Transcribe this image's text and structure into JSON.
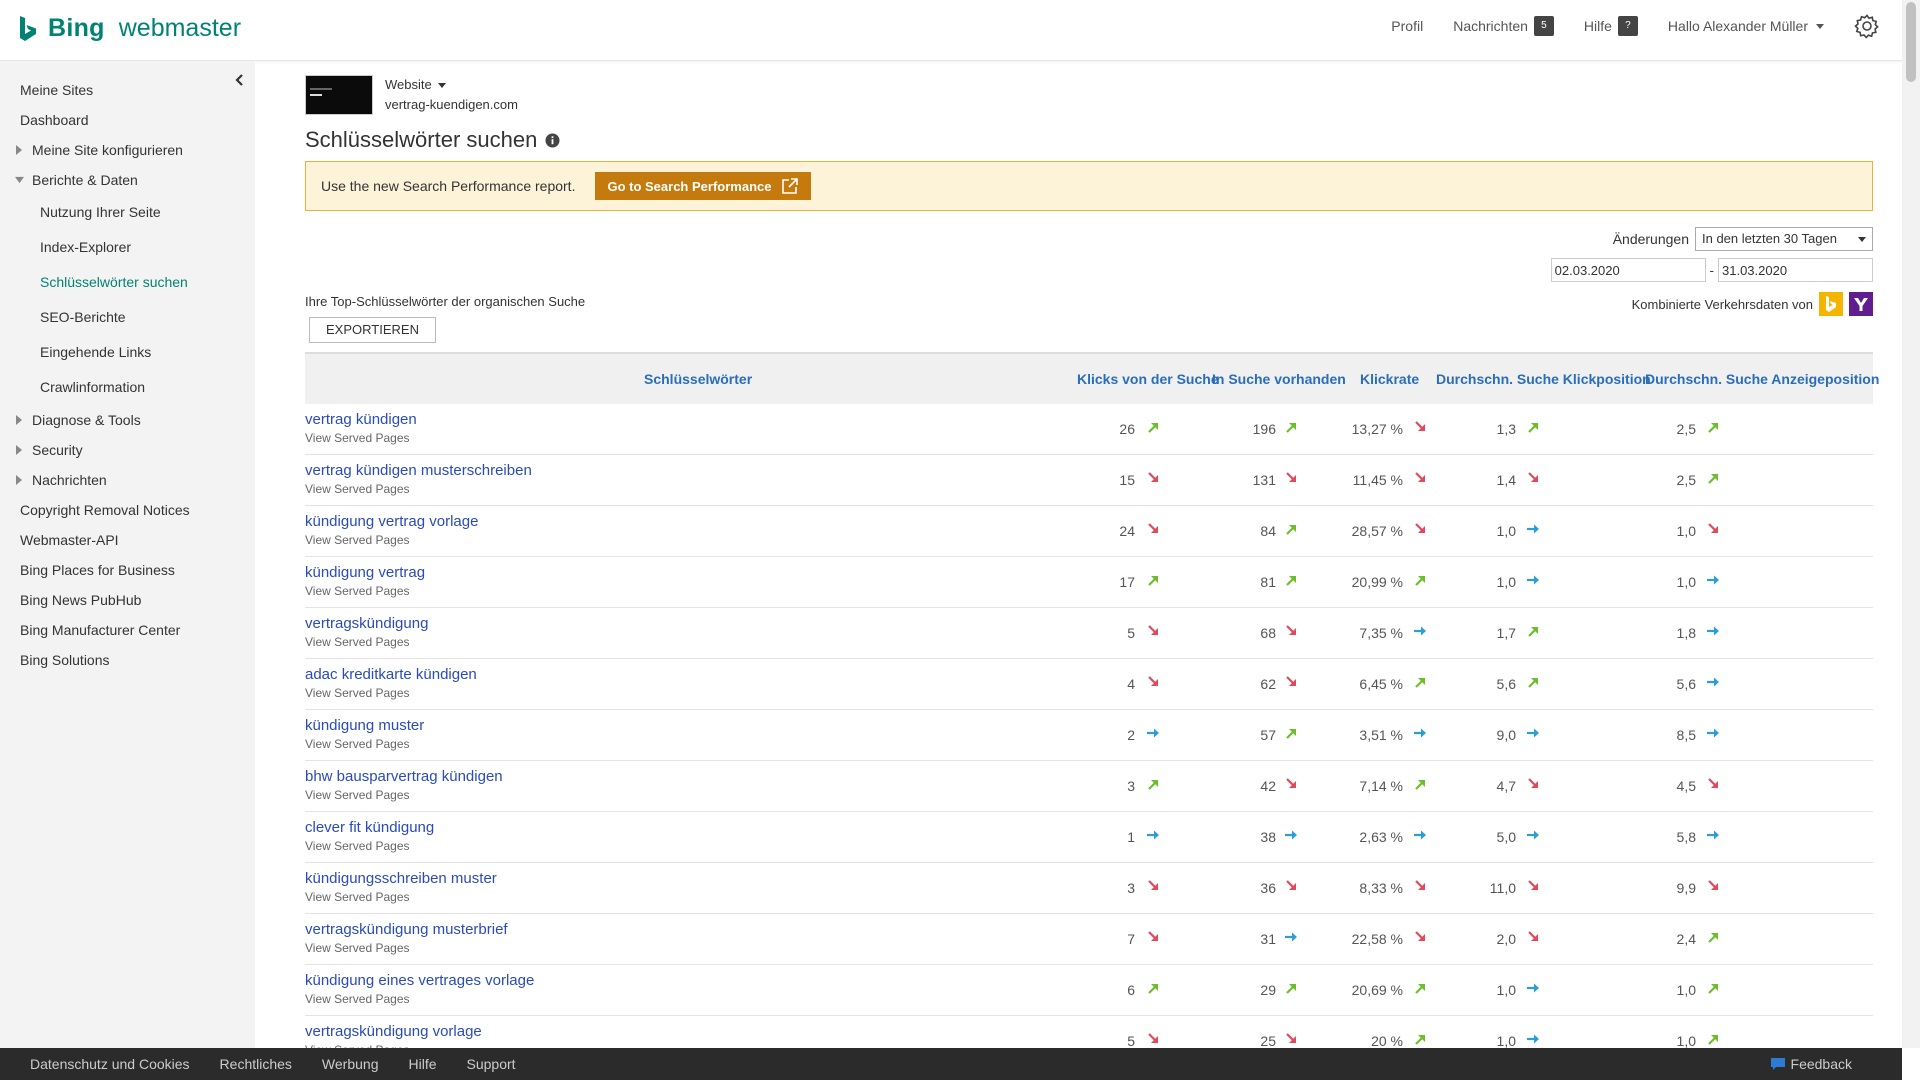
{
  "header": {
    "brand": "Bing",
    "product": "webmaster",
    "profile": "Profil",
    "messages": "Nachrichten",
    "messages_count": "5",
    "help": "Hilfe",
    "help_badge": "?",
    "greeting": "Hallo Alexander Müller"
  },
  "sidebar": {
    "items": [
      {
        "label": "Meine Sites"
      },
      {
        "label": "Dashboard"
      },
      {
        "label": "Meine Site konfigurieren"
      },
      {
        "label": "Berichte & Daten"
      },
      {
        "label": "Nutzung Ihrer Seite"
      },
      {
        "label": "Index-Explorer"
      },
      {
        "label": "Schlüsselwörter suchen"
      },
      {
        "label": "SEO-Berichte"
      },
      {
        "label": "Eingehende Links"
      },
      {
        "label": "Crawlinformation"
      },
      {
        "label": "Diagnose & Tools"
      },
      {
        "label": "Security"
      },
      {
        "label": "Nachrichten"
      },
      {
        "label": "Copyright Removal Notices"
      },
      {
        "label": "Webmaster-API"
      },
      {
        "label": "Bing Places for Business"
      },
      {
        "label": "Bing News PubHub"
      },
      {
        "label": "Bing Manufacturer Center"
      },
      {
        "label": "Bing Solutions"
      }
    ]
  },
  "site": {
    "label": "Website",
    "domain": "vertrag-kuendigen.com"
  },
  "page": {
    "title": "Schlüsselwörter suchen"
  },
  "banner": {
    "text": "Use the new Search Performance report.",
    "button": "Go to Search Performance"
  },
  "filters": {
    "changes_label": "Änderungen",
    "range": "In den letzten 30 Tagen",
    "date_from": "02.03.2020",
    "date_sep": "-",
    "date_to": "31.03.2020",
    "top_keywords_label": "Ihre Top-Schlüsselwörter der organischen Suche",
    "export": "EXPORTIEREN",
    "combined_label": "Kombinierte Verkehrsdaten von"
  },
  "table": {
    "headers": {
      "keyword": "Schlüsselwörter",
      "clicks": "Klicks von der Suche",
      "impressions": "In Suche vorhanden",
      "ctr": "Klickrate",
      "avg_click_pos": "Durchschn. Suche Klickposition",
      "avg_imp_pos": "Durchschn. Suche Anzeigeposition"
    },
    "served_pages_label": "View Served Pages",
    "rows": [
      {
        "kw": "vertrag kündigen",
        "clicks": "26",
        "ca": "up",
        "imp": "196",
        "ia": "up",
        "ctr": "13,27 %",
        "ra": "down",
        "cpos": "1,3",
        "pa": "up",
        "ipos": "2,5",
        "qa": "up"
      },
      {
        "kw": "vertrag kündigen musterschreiben",
        "clicks": "15",
        "ca": "down",
        "imp": "131",
        "ia": "down",
        "ctr": "11,45 %",
        "ra": "down",
        "cpos": "1,4",
        "pa": "down",
        "ipos": "2,5",
        "qa": "up"
      },
      {
        "kw": "kündigung vertrag vorlage",
        "clicks": "24",
        "ca": "down",
        "imp": "84",
        "ia": "up",
        "ctr": "28,57 %",
        "ra": "down",
        "cpos": "1,0",
        "pa": "right",
        "ipos": "1,0",
        "qa": "down"
      },
      {
        "kw": "kündigung vertrag",
        "clicks": "17",
        "ca": "up",
        "imp": "81",
        "ia": "up",
        "ctr": "20,99 %",
        "ra": "up",
        "cpos": "1,0",
        "pa": "right",
        "ipos": "1,0",
        "qa": "right"
      },
      {
        "kw": "vertragskündigung",
        "clicks": "5",
        "ca": "down",
        "imp": "68",
        "ia": "down",
        "ctr": "7,35 %",
        "ra": "right",
        "cpos": "1,7",
        "pa": "up",
        "ipos": "1,8",
        "qa": "right"
      },
      {
        "kw": "adac kreditkarte kündigen",
        "clicks": "4",
        "ca": "down",
        "imp": "62",
        "ia": "down",
        "ctr": "6,45 %",
        "ra": "up",
        "cpos": "5,6",
        "pa": "up",
        "ipos": "5,6",
        "qa": "right"
      },
      {
        "kw": "kündigung muster",
        "clicks": "2",
        "ca": "right",
        "imp": "57",
        "ia": "up",
        "ctr": "3,51 %",
        "ra": "right",
        "cpos": "9,0",
        "pa": "right",
        "ipos": "8,5",
        "qa": "right"
      },
      {
        "kw": "bhw bausparvertrag kündigen",
        "clicks": "3",
        "ca": "up",
        "imp": "42",
        "ia": "down",
        "ctr": "7,14 %",
        "ra": "up",
        "cpos": "4,7",
        "pa": "down",
        "ipos": "4,5",
        "qa": "down"
      },
      {
        "kw": "clever fit kündigung",
        "clicks": "1",
        "ca": "right",
        "imp": "38",
        "ia": "right",
        "ctr": "2,63 %",
        "ra": "right",
        "cpos": "5,0",
        "pa": "right",
        "ipos": "5,8",
        "qa": "right"
      },
      {
        "kw": "kündigungsschreiben muster",
        "clicks": "3",
        "ca": "down",
        "imp": "36",
        "ia": "down",
        "ctr": "8,33 %",
        "ra": "down",
        "cpos": "11,0",
        "pa": "down",
        "ipos": "9,9",
        "qa": "down"
      },
      {
        "kw": "vertragskündigung musterbrief",
        "clicks": "7",
        "ca": "down",
        "imp": "31",
        "ia": "right",
        "ctr": "22,58 %",
        "ra": "down",
        "cpos": "2,0",
        "pa": "down",
        "ipos": "2,4",
        "qa": "up"
      },
      {
        "kw": "kündigung eines vertrages vorlage",
        "clicks": "6",
        "ca": "up",
        "imp": "29",
        "ia": "up",
        "ctr": "20,69 %",
        "ra": "up",
        "cpos": "1,0",
        "pa": "right",
        "ipos": "1,0",
        "qa": "up"
      },
      {
        "kw": "vertragskündigung vorlage",
        "clicks": "5",
        "ca": "down",
        "imp": "25",
        "ia": "down",
        "ctr": "20 %",
        "ra": "up",
        "cpos": "1,0",
        "pa": "right",
        "ipos": "1,0",
        "qa": "up"
      }
    ]
  },
  "footer": {
    "links": [
      "Datenschutz und Cookies",
      "Rechtliches",
      "Werbung",
      "Hilfe",
      "Support"
    ],
    "feedback": "Feedback"
  },
  "colors": {
    "brand_teal": "#008373",
    "link_blue": "#2a4bb8",
    "header_blue": "#2a6ebb",
    "arrow_up": "#6cbf2a",
    "arrow_down": "#e04a5c",
    "arrow_right": "#2b9ed8",
    "banner_bg": "#fdf3d9",
    "banner_button": "#c47a0c"
  },
  "icons": {
    "trend_up": "arrow-up-right-icon",
    "trend_down": "arrow-down-right-icon",
    "trend_flat": "arrow-right-icon"
  }
}
